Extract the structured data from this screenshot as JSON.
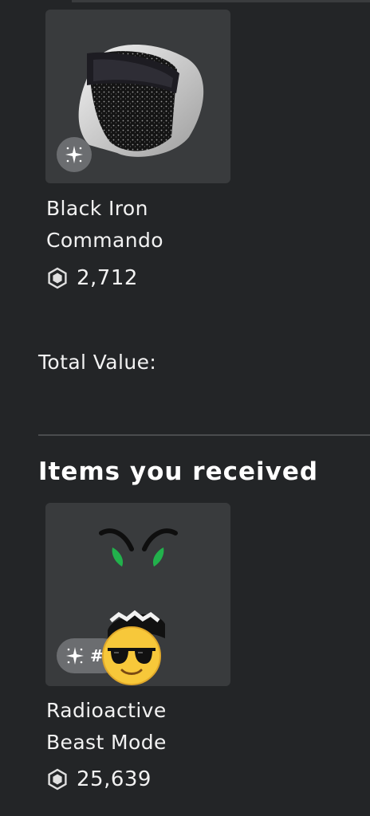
{
  "offered_items": [
    {
      "name_line1": "Black Iron",
      "name_line2": "Commando",
      "price": "2,712",
      "icon": "black-iron-commando-thumbnail"
    }
  ],
  "total_value_label": "Total Value:",
  "received_section": {
    "title": "Items you received",
    "items": [
      {
        "name_line1": "Radioactive",
        "name_line2": "Beast Mode",
        "price": "25,639",
        "badge_text": "#",
        "icon": "radioactive-beast-mode-thumbnail"
      }
    ]
  },
  "colors": {
    "background": "#232527",
    "card": "#393b3d",
    "badge": "#6b6d70",
    "accent_green": "#22b14c"
  }
}
